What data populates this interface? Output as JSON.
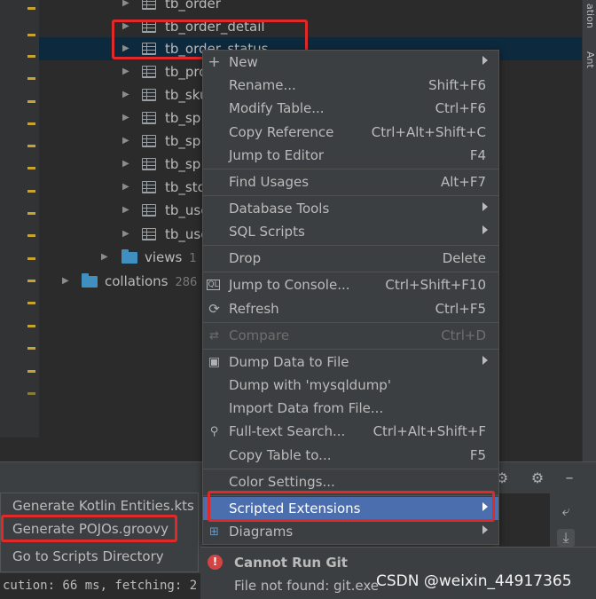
{
  "tree": {
    "rows": [
      {
        "name": "tb_order",
        "kind": "table"
      },
      {
        "name": "tb_order_detail",
        "kind": "table"
      },
      {
        "name": "tb_order_status",
        "kind": "table",
        "selected": true
      },
      {
        "name": "tb_pro",
        "kind": "table"
      },
      {
        "name": "tb_sku",
        "kind": "table"
      },
      {
        "name": "tb_sp",
        "kind": "table"
      },
      {
        "name": "tb_sp",
        "kind": "table"
      },
      {
        "name": "tb_sp",
        "kind": "table"
      },
      {
        "name": "tb_sto",
        "kind": "table"
      },
      {
        "name": "tb_use",
        "kind": "table"
      },
      {
        "name": "tb_use",
        "kind": "table"
      }
    ],
    "views": {
      "name": "views",
      "count": "1"
    },
    "collations": {
      "name": "collations",
      "count": "286"
    }
  },
  "right_strip": {
    "top_text": "ation",
    "bottom_text": "Ant"
  },
  "context_menu": {
    "items": [
      {
        "label": "New",
        "shortcut": "",
        "submenu": true,
        "icon": "plus-icon"
      },
      {
        "label": "Rename...",
        "shortcut": "Shift+F6"
      },
      {
        "label": "Modify Table...",
        "shortcut": "Ctrl+F6"
      },
      {
        "label": "Copy Reference",
        "shortcut": "Ctrl+Alt+Shift+C"
      },
      {
        "label": "Jump to Editor",
        "shortcut": "F4"
      },
      {
        "label": "Find Usages",
        "shortcut": "Alt+F7"
      },
      {
        "label": "Database Tools",
        "shortcut": "",
        "submenu": true
      },
      {
        "label": "SQL Scripts",
        "shortcut": "",
        "submenu": true
      },
      {
        "label": "Drop",
        "shortcut": "Delete"
      },
      {
        "label": "Jump to Console...",
        "shortcut": "Ctrl+Shift+F10",
        "icon": "console-icon"
      },
      {
        "label": "Refresh",
        "shortcut": "Ctrl+F5",
        "icon": "refresh-icon"
      },
      {
        "label": "Compare",
        "shortcut": "Ctrl+D",
        "icon": "compare-icon",
        "disabled": true
      },
      {
        "label": "Dump Data to File",
        "shortcut": "",
        "submenu": true,
        "icon": "save-icon"
      },
      {
        "label": "Dump with 'mysqldump'",
        "shortcut": ""
      },
      {
        "label": "Import Data from File...",
        "shortcut": ""
      },
      {
        "label": "Full-text Search...",
        "shortcut": "Ctrl+Alt+Shift+F",
        "icon": "search-icon"
      },
      {
        "label": "Copy Table to...",
        "shortcut": "F5"
      },
      {
        "label": "Color Settings...",
        "shortcut": ""
      },
      {
        "label": "Scripted Extensions",
        "shortcut": "",
        "submenu": true,
        "active": true
      },
      {
        "label": "Diagrams",
        "shortcut": "",
        "submenu": true,
        "icon": "diagram-icon"
      }
    ]
  },
  "scripts_submenu": {
    "items": [
      {
        "label": "Generate Kotlin Entities.kts"
      },
      {
        "label": "Generate POJOs.groovy"
      },
      {
        "label": "Go to Scripts Directory"
      }
    ]
  },
  "status_line": "cution: 66 ms, fetching: 2",
  "notification": {
    "title": "Cannot Run Git",
    "message": "File not found: git.exe"
  },
  "watermark": "CSDN @weixin_44917365",
  "colors": {
    "selection": "#4b6eaf",
    "highlight_box": "#e02a2a",
    "error": "#d14545",
    "folder": "#3f8fc1"
  }
}
